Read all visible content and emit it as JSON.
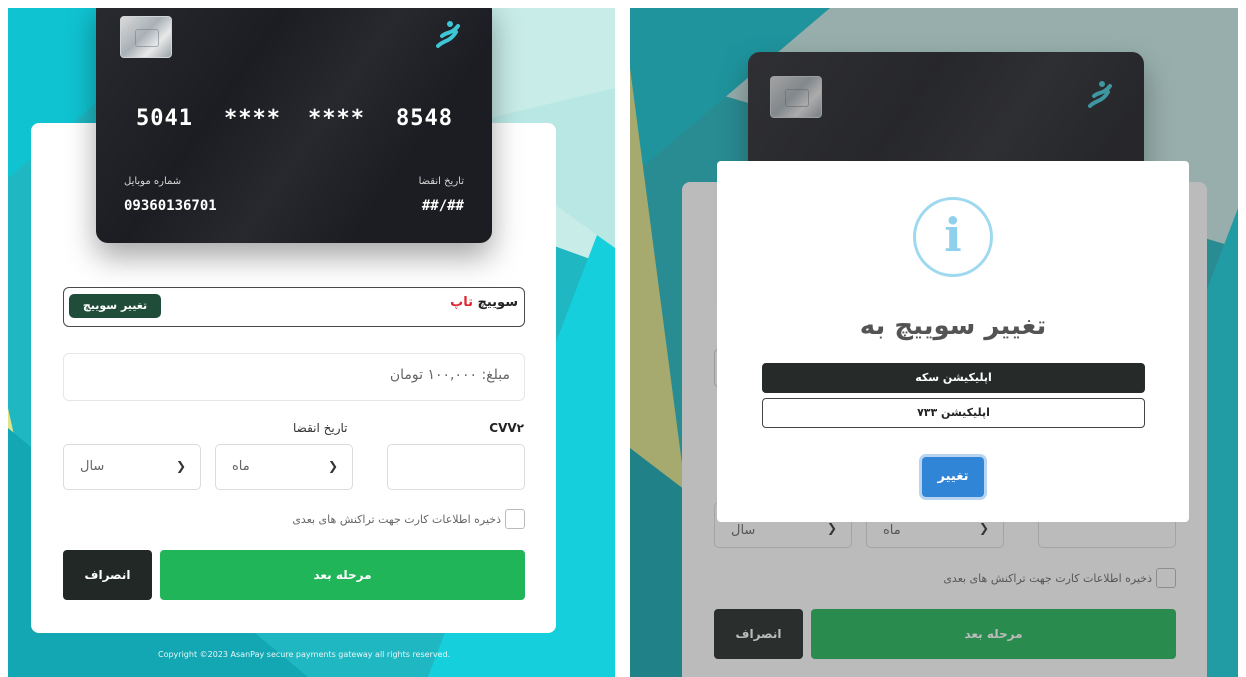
{
  "left": {
    "card": {
      "number_groups": [
        "5041",
        "****",
        "****",
        "8548"
      ],
      "mobile_label": "شماره موبایل",
      "mobile_value": "09360136701",
      "expiry_label": "تاریخ انقضا",
      "expiry_value": "##/##",
      "logo_icon": "bank-logo-icon"
    },
    "switch": {
      "title_black": "سوییچ",
      "title_red": "تاپ",
      "button": "تغییر سوییچ"
    },
    "amount": "مبلغ: ۱۰۰,۰۰۰ تومان",
    "cvv_label": "CVV۲",
    "expiry_label": "تاریخ انقضا",
    "month_placeholder": "ماه",
    "year_placeholder": "سال",
    "save_card": "ذخیره اطلاعات کارت جهت تراکنش های بعدی",
    "next_button": "مرحله بعد",
    "cancel_button": "انصراف",
    "copyright": "Copyright ©2023 AsanPay secure payments gateway all rights reserved."
  },
  "right": {
    "modal": {
      "title": "تغییر سوییچ به",
      "options": [
        "اپلیکیشن سکه",
        "اپلیکیشن ۷۳۳"
      ],
      "selected_index": 0,
      "confirm": "تغییر",
      "icon": "info-icon"
    },
    "month_placeholder": "ماه",
    "year_placeholder": "سال",
    "save_card": "ذخیره اطلاعات کارت جهت تراکنش های بعدی",
    "next_button": "مرحله بعد",
    "cancel_button": "انصراف"
  },
  "colors": {
    "teal": "#17b6c4",
    "green": "#21b55a",
    "dark": "#212826",
    "red": "#e0262f",
    "blue": "#3085d6"
  }
}
